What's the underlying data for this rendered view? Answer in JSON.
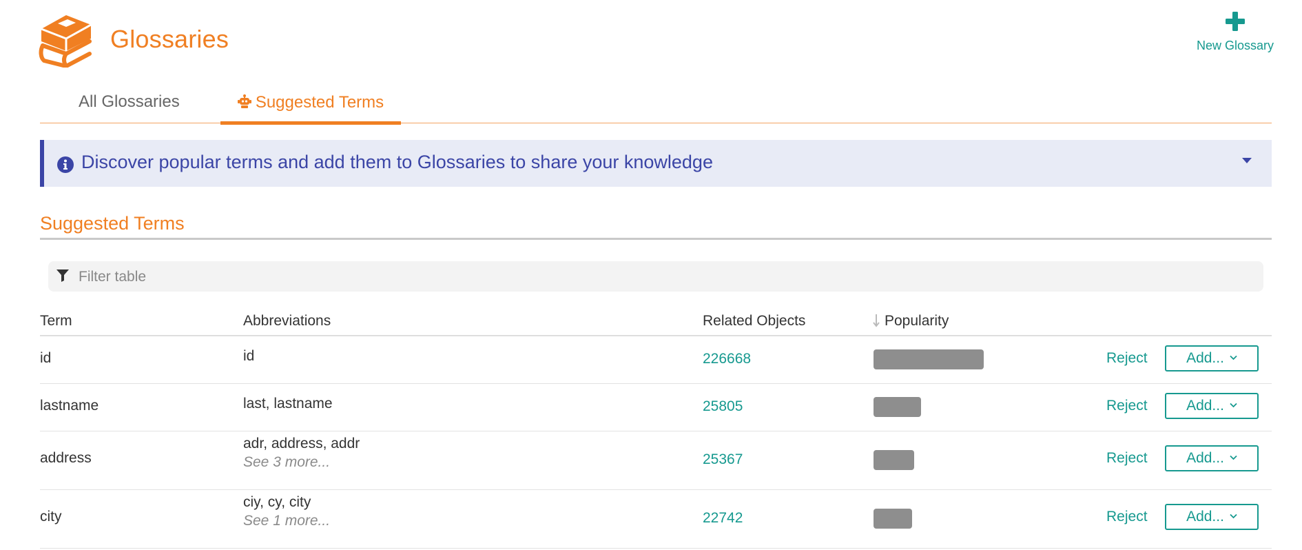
{
  "header": {
    "title": "Glossaries",
    "new_button_label": "New Glossary",
    "logo_icon": "books-stack-icon",
    "accent_color": "#f07f22",
    "teal_color": "#16998f"
  },
  "tabs": [
    {
      "label": "All Glossaries",
      "active": false
    },
    {
      "label": "Suggested Terms",
      "active": true,
      "icon": "robot-icon"
    }
  ],
  "banner": {
    "text": "Discover popular terms and add them to Glossaries to share your knowledge",
    "icon": "info-icon",
    "color": "#3b45a6",
    "background": "#e8ebf6"
  },
  "section": {
    "title": "Suggested Terms"
  },
  "filter": {
    "placeholder": "Filter table",
    "value": ""
  },
  "table": {
    "columns": {
      "term": "Term",
      "abbreviations": "Abbreviations",
      "related": "Related Objects",
      "popularity": "Popularity"
    },
    "sort": {
      "column": "popularity",
      "direction": "descending"
    },
    "action_reject": "Reject",
    "action_add": "Add...",
    "rows": [
      {
        "term": "id",
        "abbreviations": "id",
        "more": "",
        "related": "226668",
        "popularity": 1.0
      },
      {
        "term": "lastname",
        "abbreviations": "last, lastname",
        "more": "",
        "related": "25805",
        "popularity": 0.43
      },
      {
        "term": "address",
        "abbreviations": "adr, address, addr",
        "more": "See 3 more...",
        "related": "25367",
        "popularity": 0.37
      },
      {
        "term": "city",
        "abbreviations": "ciy, cy, city",
        "more": "See 1 more...",
        "related": "22742",
        "popularity": 0.35
      }
    ]
  }
}
